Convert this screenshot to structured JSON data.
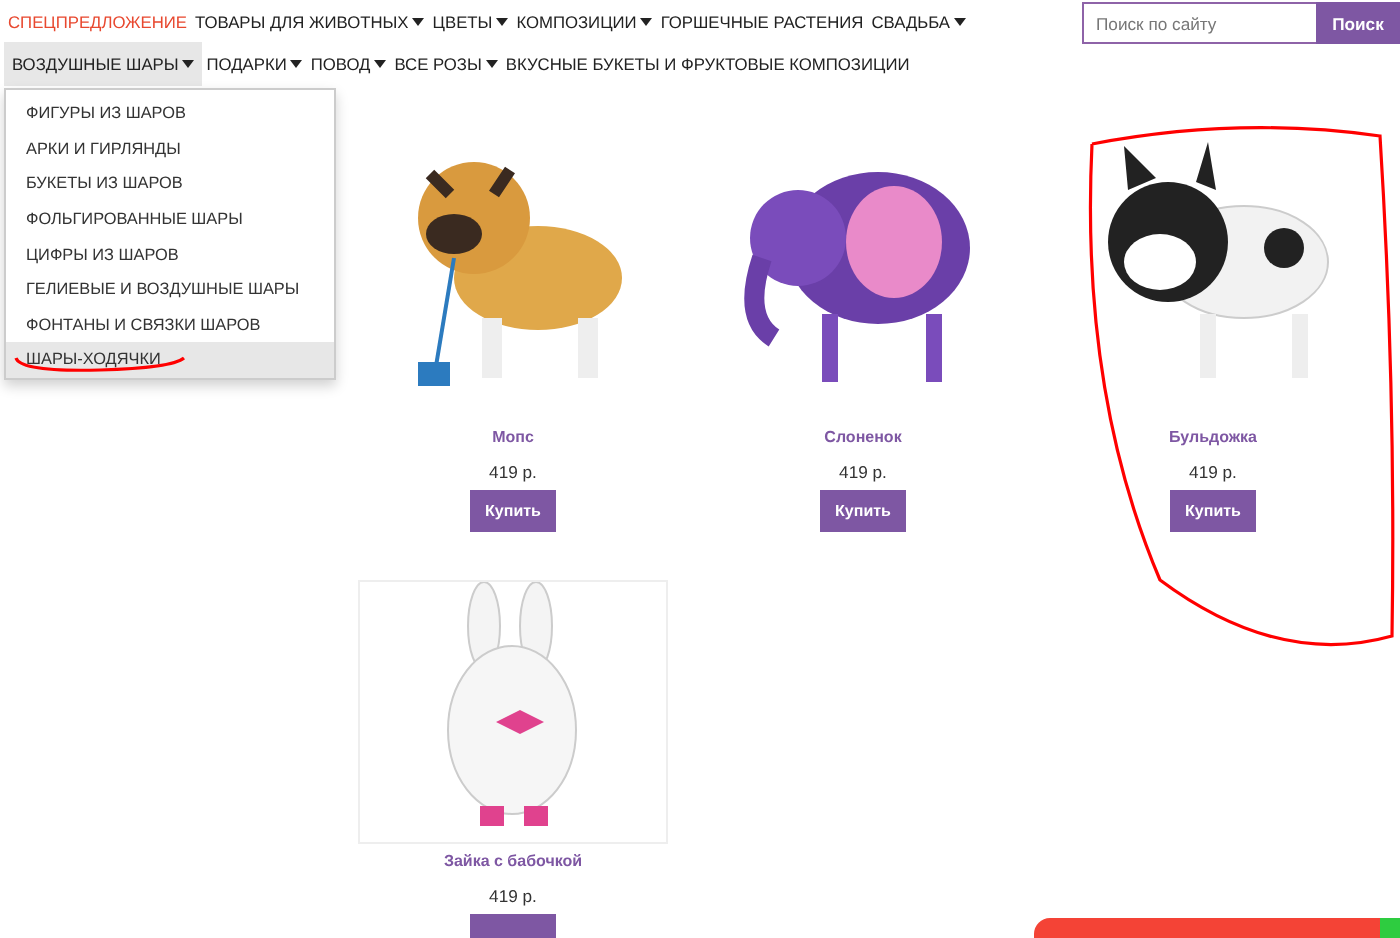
{
  "nav_primary": [
    {
      "label": "СПЕЦПРЕДЛОЖЕНИЕ",
      "caret": false,
      "highlighted": true,
      "selected": false
    },
    {
      "label": "ТОВАРЫ ДЛЯ ЖИВОТНЫХ",
      "caret": true,
      "highlighted": false,
      "selected": false
    },
    {
      "label": "ЦВЕТЫ",
      "caret": true,
      "highlighted": false,
      "selected": false
    },
    {
      "label": "КОМПОЗИЦИИ",
      "caret": true,
      "highlighted": false,
      "selected": false
    },
    {
      "label": "ГОРШЕЧНЫЕ РАСТЕНИЯ",
      "caret": false,
      "highlighted": false,
      "selected": false
    },
    {
      "label": "СВАДЬБА",
      "caret": true,
      "highlighted": false,
      "selected": false
    }
  ],
  "search": {
    "placeholder": "Поиск по сайту",
    "button": "Поиск"
  },
  "nav_secondary": [
    {
      "label": "ВОЗДУШНЫЕ ШАРЫ",
      "caret": true,
      "highlighted": false,
      "selected": true
    },
    {
      "label": "ПОДАРКИ",
      "caret": true,
      "highlighted": false,
      "selected": false
    },
    {
      "label": "ПОВОД",
      "caret": true,
      "highlighted": false,
      "selected": false
    },
    {
      "label": "ВСЕ РОЗЫ",
      "caret": true,
      "highlighted": false,
      "selected": false
    },
    {
      "label": "ВКУСНЫЕ БУКЕТЫ И ФРУКТОВЫЕ КОМПОЗИЦИИ",
      "caret": false,
      "highlighted": false,
      "selected": false
    }
  ],
  "dropdown": {
    "items": [
      {
        "label": "ФИГУРЫ ИЗ ШАРОВ",
        "selected": false
      },
      {
        "label": "АРКИ И ГИРЛЯНДЫ",
        "selected": false
      },
      {
        "label": "БУКЕТЫ ИЗ ШАРОВ",
        "selected": false
      },
      {
        "label": "ФОЛЬГИРОВАННЫЕ ШАРЫ",
        "selected": false
      },
      {
        "label": "ЦИФРЫ ИЗ ШАРОВ",
        "selected": false
      },
      {
        "label": "ГЕЛИЕВЫЕ И ВОЗДУШНЫЕ ШАРЫ",
        "selected": false
      },
      {
        "label": "ФОНТАНЫ И СВЯЗКИ ШАРОВ",
        "selected": false
      },
      {
        "label": "ШАРЫ-ХОДЯЧКИ",
        "selected": true
      }
    ]
  },
  "products": [
    {
      "kind": "pug",
      "name": "Мопс",
      "price": "419 р.",
      "button": "Купить"
    },
    {
      "kind": "elephant",
      "name": "Слоненок",
      "price": "419 р.",
      "button": "Купить"
    },
    {
      "kind": "bulldog",
      "name": "Бульдожка",
      "price": "419 р.",
      "button": "Купить"
    },
    {
      "kind": "bunny",
      "name": "Зайка с бабочкой",
      "price": "419 р."
    }
  ],
  "annotations": [
    {
      "kind": "underline"
    },
    {
      "kind": "circle"
    }
  ]
}
